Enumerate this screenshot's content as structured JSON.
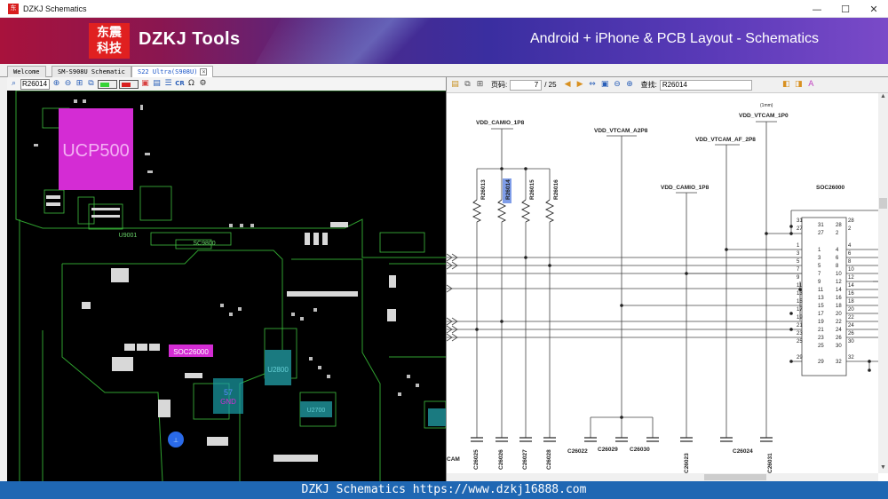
{
  "window": {
    "title": "DZKJ Schematics",
    "minimize": "—",
    "maximize": "☐",
    "close": "✕",
    "icon_text": "东"
  },
  "banner": {
    "logo_line1": "东震",
    "logo_line2": "科技",
    "brand": "DZKJ Tools",
    "tagline": "Android + iPhone & PCB Layout - Schematics"
  },
  "tabs": [
    {
      "label": "Welcome",
      "active": false
    },
    {
      "label": "SM-S908U Schematic",
      "active": false
    },
    {
      "label": "S22 Ultra(S908U)",
      "active": true
    }
  ],
  "left_toolbar": {
    "search_value": "R26014",
    "cr_label": "CR",
    "omega_label": "Ω"
  },
  "right_toolbar": {
    "page_label": "页码:",
    "page_current": "7",
    "page_total": "/ 25",
    "search_label": "查找:",
    "search_value": "R26014"
  },
  "pcb": {
    "chip_main": "UCP500",
    "chip_a": "U9001",
    "chip_b": "SC9800",
    "chip_c": "U2800",
    "chip_d": "SOC26000",
    "chip_e": "U2700",
    "gnd_num": "57",
    "gnd_label": "GND",
    "colors": {
      "board": "#000000",
      "outline": "#2fa02f",
      "pad": "#d8d8d8",
      "highlight": "#d42cd4",
      "cyan_comp": "#1aa0a8"
    }
  },
  "schematic": {
    "rails": {
      "vdd_camio_1": "VDD_CAMIO_1P8",
      "vdd_vtcam_a2": "VDD_VTCAM_A2P8",
      "vdd_vtcam_af": "VDD_VTCAM_AF_2P8",
      "vdd_camio_2": "VDD_CAMIO_1P8",
      "vdd_vtcam_1p0": "VDD_VTCAM_1P0",
      "one_mm": "(1mm)"
    },
    "resistors": [
      "R26013",
      "R26014",
      "R26015",
      "R26016"
    ],
    "caps": [
      "C26025",
      "C26026",
      "C26027",
      "C26028",
      "C26022",
      "C26029",
      "C26030",
      "C26023",
      "C26024",
      "C26031"
    ],
    "cam_label": "CAM",
    "ic_name": "SOC26000",
    "left_pins": [
      "31",
      "27",
      "1",
      "3",
      "5",
      "7",
      "9",
      "11",
      "13",
      "15",
      "17",
      "19",
      "21",
      "23",
      "25",
      "29"
    ],
    "inner_left": [
      "31",
      "27",
      "1",
      "3",
      "5",
      "7",
      "9",
      "11",
      "13",
      "15",
      "17",
      "19",
      "21",
      "23",
      "25",
      "29"
    ],
    "inner_right": [
      "28",
      "2",
      "4",
      "6",
      "8",
      "10",
      "12",
      "14",
      "16",
      "18",
      "20",
      "22",
      "24",
      "26",
      "30",
      "32"
    ],
    "right_pins": [
      "28",
      "2",
      "4",
      "6",
      "8",
      "10",
      "12",
      "14",
      "16",
      "18",
      "20",
      "22",
      "24",
      "26",
      "30",
      "32"
    ]
  },
  "statusbar": {
    "text": "DZKJ Schematics https://www.dzkj16888.com"
  }
}
